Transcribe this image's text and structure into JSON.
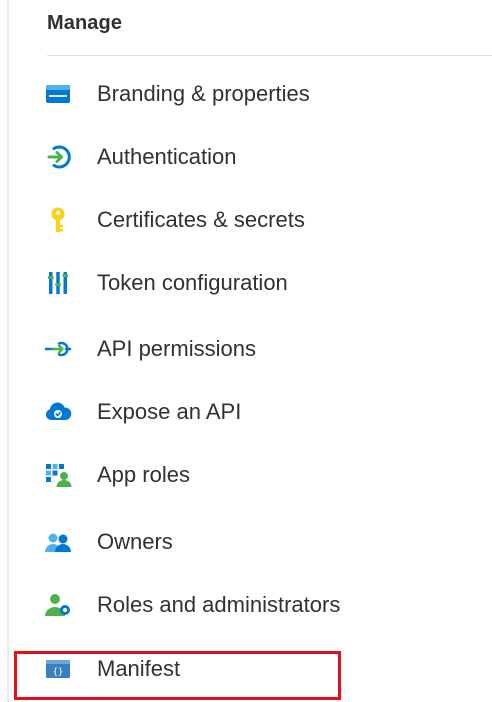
{
  "section": {
    "title": "Manage"
  },
  "nav_items": [
    {
      "label": "Branding & properties",
      "icon": "branding-icon"
    },
    {
      "label": "Authentication",
      "icon": "authentication-icon"
    },
    {
      "label": "Certificates & secrets",
      "icon": "key-icon"
    },
    {
      "label": "Token configuration",
      "icon": "token-configuration-icon"
    },
    {
      "label": "API permissions",
      "icon": "api-permissions-icon"
    },
    {
      "label": "Expose an API",
      "icon": "cloud-icon"
    },
    {
      "label": "App roles",
      "icon": "app-roles-icon"
    },
    {
      "label": "Owners",
      "icon": "owners-icon"
    },
    {
      "label": "Roles and administrators",
      "icon": "roles-admin-icon"
    },
    {
      "label": "Manifest",
      "icon": "manifest-icon"
    }
  ],
  "highlight": {
    "target": "Manifest",
    "color": "#e3101a"
  },
  "colors": {
    "azure_blue": "#0078d4",
    "green": "#4db24d",
    "key_yellow": "#fcd116",
    "text": "#323130"
  }
}
